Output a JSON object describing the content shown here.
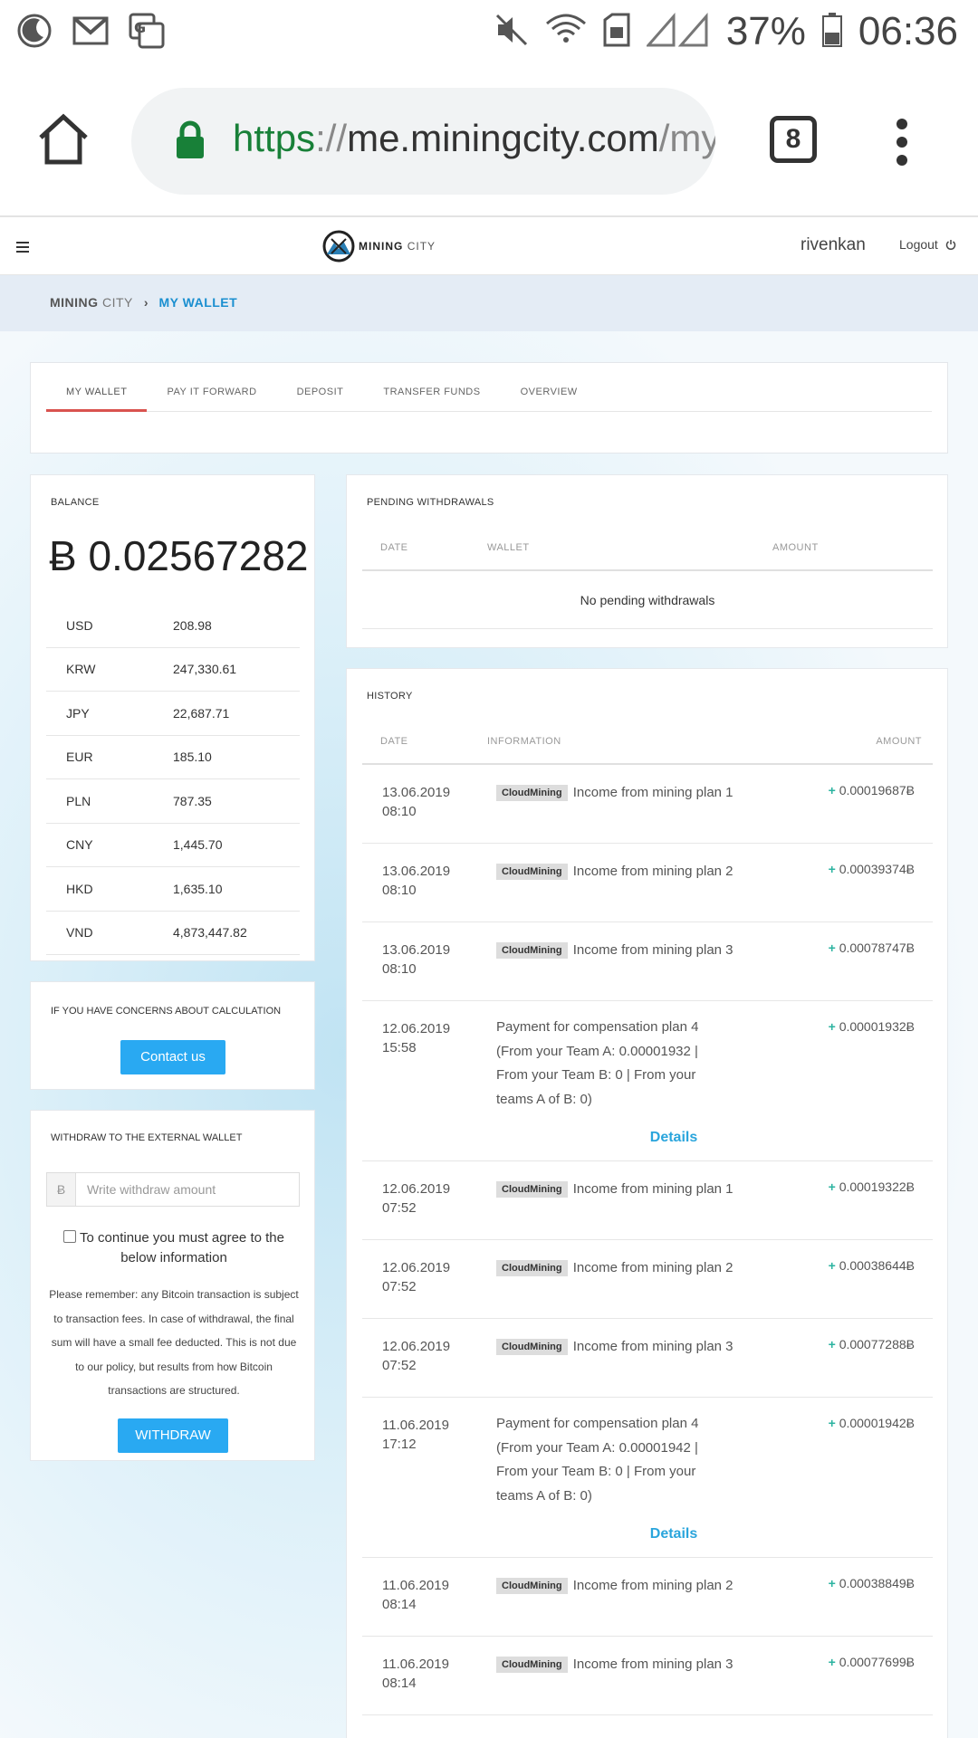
{
  "status_bar": {
    "battery": "37%",
    "time": "06:36",
    "icons": [
      "moon-icon",
      "gmail-icon",
      "translate-icon",
      "mute-icon",
      "wifi-icon",
      "sim-icon",
      "signal-icon",
      "battery-icon"
    ]
  },
  "browser": {
    "url_scheme": "https",
    "url_sep": "://",
    "url_host": "me.miningcity.com",
    "url_path": "/my",
    "tab_count": "8"
  },
  "header": {
    "logo_bold": "MINING",
    "logo_light": "CITY",
    "username": "rivenkan",
    "logout": "Logout"
  },
  "breadcrumb": {
    "root_bold": "MINING",
    "root_light": "CITY",
    "separator": "›",
    "current": "MY WALLET"
  },
  "tabs": [
    "MY WALLET",
    "PAY IT FORWARD",
    "DEPOSIT",
    "TRANSFER FUNDS",
    "OVERVIEW"
  ],
  "balance": {
    "title": "BALANCE",
    "amount": "Ƀ 0.02567282",
    "rates": [
      {
        "currency": "USD",
        "value": "208.98"
      },
      {
        "currency": "KRW",
        "value": "247,330.61"
      },
      {
        "currency": "JPY",
        "value": "22,687.71"
      },
      {
        "currency": "EUR",
        "value": "185.10"
      },
      {
        "currency": "PLN",
        "value": "787.35"
      },
      {
        "currency": "CNY",
        "value": "1,445.70"
      },
      {
        "currency": "HKD",
        "value": "1,635.10"
      },
      {
        "currency": "VND",
        "value": "4,873,447.82"
      }
    ]
  },
  "concerns": {
    "title": "IF YOU HAVE CONCERNS ABOUT CALCULATION",
    "button": "Contact us"
  },
  "withdraw": {
    "title": "WITHDRAW TO THE EXTERNAL WALLET",
    "prefix": "Ƀ",
    "placeholder": "Write withdraw amount",
    "agree": "To continue you must agree to the below information",
    "notice": "Please remember: any Bitcoin transaction is subject to transaction fees. In case of withdrawal, the final sum will have a small fee deducted. This is not due to our policy, but results from how Bitcoin transactions are structured.",
    "button": "WITHDRAW"
  },
  "pending": {
    "title": "PENDING WITHDRAWALS",
    "col_date": "DATE",
    "col_wallet": "WALLET",
    "col_amount": "AMOUNT",
    "empty": "No pending withdrawals"
  },
  "history": {
    "title": "HISTORY",
    "col_date": "DATE",
    "col_info": "INFORMATION",
    "col_amount": "AMOUNT",
    "details_label": "Details",
    "rows": [
      {
        "date": "13.06.2019",
        "time": "08:10",
        "badge": "CloudMining",
        "info": "Income from mining plan 1",
        "amount": "0.00019687Ƀ"
      },
      {
        "date": "13.06.2019",
        "time": "08:10",
        "badge": "CloudMining",
        "info": "Income from mining plan 2",
        "amount": "0.00039374Ƀ"
      },
      {
        "date": "13.06.2019",
        "time": "08:10",
        "badge": "CloudMining",
        "info": "Income from mining plan 3",
        "amount": "0.00078747Ƀ"
      },
      {
        "date": "12.06.2019",
        "time": "15:58",
        "badge": "",
        "info": "Payment for compensation plan 4 (From your Team A: 0.00001932 | From your Team B: 0 | From your teams A of B: 0)",
        "amount": "0.00001932Ƀ"
      },
      {
        "date": "12.06.2019",
        "time": "07:52",
        "badge": "CloudMining",
        "info": "Income from mining plan 1",
        "amount": "0.00019322Ƀ"
      },
      {
        "date": "12.06.2019",
        "time": "07:52",
        "badge": "CloudMining",
        "info": "Income from mining plan 2",
        "amount": "0.00038644Ƀ"
      },
      {
        "date": "12.06.2019",
        "time": "07:52",
        "badge": "CloudMining",
        "info": "Income from mining plan 3",
        "amount": "0.00077288Ƀ"
      },
      {
        "date": "11.06.2019",
        "time": "17:12",
        "badge": "",
        "info": "Payment for compensation plan 4 (From your Team A: 0.00001942 | From your Team B: 0 | From your teams A of B: 0)",
        "amount": "0.00001942Ƀ"
      },
      {
        "date": "11.06.2019",
        "time": "08:14",
        "badge": "CloudMining",
        "info": "Income from mining plan 2",
        "amount": "0.00038849Ƀ"
      },
      {
        "date": "11.06.2019",
        "time": "08:14",
        "badge": "CloudMining",
        "info": "Income from mining plan 3",
        "amount": "0.00077699Ƀ"
      }
    ]
  }
}
